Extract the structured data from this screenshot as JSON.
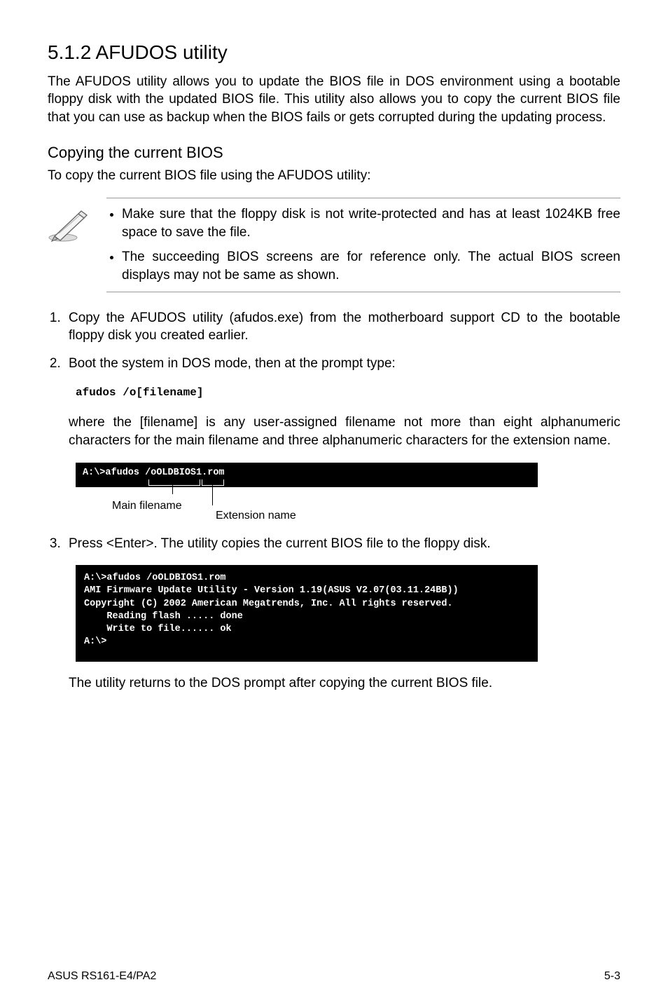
{
  "section": {
    "number": "5.1.2",
    "title": "AFUDOS utility",
    "intro": "The AFUDOS utility allows you to update the BIOS file in DOS environment using a bootable floppy disk with the updated BIOS file. This utility also allows you to copy the current BIOS file that you can use as backup when the BIOS fails or gets corrupted during the updating process."
  },
  "copying": {
    "title": "Copying the current BIOS",
    "lead": "To copy the current BIOS file using the AFUDOS utility:"
  },
  "notes": [
    "Make sure that the floppy disk is not write-protected and has at least 1024KB free space to save the file.",
    "The succeeding BIOS screens are for reference only. The actual BIOS screen displays may not be same as shown."
  ],
  "steps": {
    "s1": "Copy the AFUDOS utility (afudos.exe) from the motherboard support CD to the bootable floppy disk you created earlier.",
    "s2": "Boot the system in DOS mode, then at the prompt type:",
    "code": "afudos /o[filename]",
    "s2_detail": "where the [filename] is any user-assigned filename not more than eight alphanumeric characters  for the main filename and three alphanumeric characters for the extension name.",
    "terminal1": "A:\\>afudos /oOLDBIOS1.rom",
    "annot": {
      "main": "Main filename",
      "ext": "Extension name"
    },
    "s3": "Press <Enter>. The utility copies the current BIOS file to the floppy disk.",
    "terminal2": "A:\\>afudos /oOLDBIOS1.rom\nAMI Firmware Update Utility - Version 1.19(ASUS V2.07(03.11.24BB))\nCopyright (C) 2002 American Megatrends, Inc. All rights reserved.\n    Reading flash ..... done\n    Write to file...... ok\nA:\\>",
    "s3_after": "The utility returns to the DOS prompt after copying the current BIOS file."
  },
  "footer": {
    "left": "ASUS RS161-E4/PA2",
    "right": "5-3"
  }
}
